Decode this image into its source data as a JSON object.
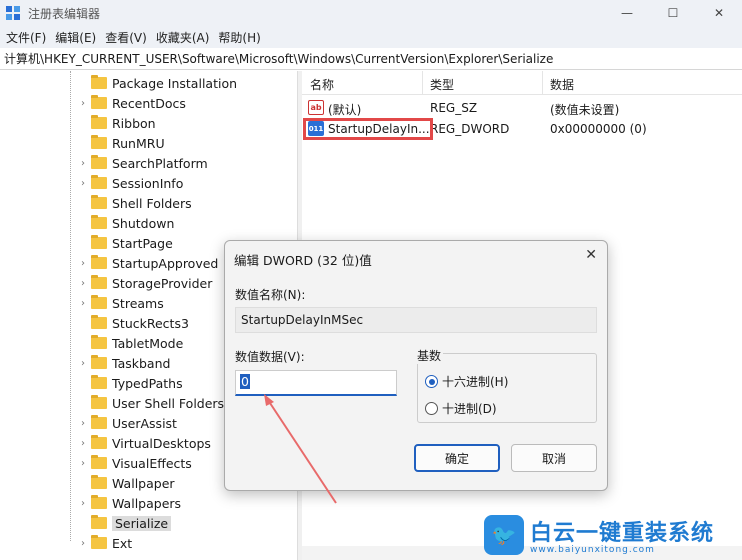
{
  "window": {
    "title": "注册表编辑器",
    "minimize": "—",
    "maximize": "☐",
    "close": "✕"
  },
  "menu": [
    "文件(F)",
    "编辑(E)",
    "查看(V)",
    "收藏夹(A)",
    "帮助(H)"
  ],
  "address": "计算机\\HKEY_CURRENT_USER\\Software\\Microsoft\\Windows\\CurrentVersion\\Explorer\\Serialize",
  "tree": {
    "items": [
      {
        "label": "Package Installation",
        "chevron": ""
      },
      {
        "label": "RecentDocs",
        "chevron": "›"
      },
      {
        "label": "Ribbon",
        "chevron": ""
      },
      {
        "label": "RunMRU",
        "chevron": ""
      },
      {
        "label": "SearchPlatform",
        "chevron": "›"
      },
      {
        "label": "SessionInfo",
        "chevron": "›"
      },
      {
        "label": "Shell Folders",
        "chevron": ""
      },
      {
        "label": "Shutdown",
        "chevron": ""
      },
      {
        "label": "StartPage",
        "chevron": ""
      },
      {
        "label": "StartupApproved",
        "chevron": "›"
      },
      {
        "label": "StorageProvider",
        "chevron": "›"
      },
      {
        "label": "Streams",
        "chevron": "›"
      },
      {
        "label": "StuckRects3",
        "chevron": ""
      },
      {
        "label": "TabletMode",
        "chevron": ""
      },
      {
        "label": "Taskband",
        "chevron": "›"
      },
      {
        "label": "TypedPaths",
        "chevron": ""
      },
      {
        "label": "User Shell Folders",
        "chevron": ""
      },
      {
        "label": "UserAssist",
        "chevron": "›"
      },
      {
        "label": "VirtualDesktops",
        "chevron": "›"
      },
      {
        "label": "VisualEffects",
        "chevron": "›"
      },
      {
        "label": "Wallpaper",
        "chevron": ""
      },
      {
        "label": "Wallpapers",
        "chevron": "›"
      },
      {
        "label": "Serialize",
        "chevron": "",
        "selected": true
      },
      {
        "label": "Ext",
        "chevron": "›"
      }
    ]
  },
  "list": {
    "headers": {
      "name": "名称",
      "type": "类型",
      "data": "数据"
    },
    "rows": [
      {
        "icon": "ab",
        "name": "(默认)",
        "type": "REG_SZ",
        "data": "(数值未设置)"
      },
      {
        "icon": "011",
        "name": "StartupDelayIn...",
        "type": "REG_DWORD",
        "data": "0x00000000 (0)"
      }
    ]
  },
  "dialog": {
    "title": "编辑 DWORD (32 位)值",
    "close": "✕",
    "name_label": "数值名称(N):",
    "name_value": "StartupDelayInMSec",
    "data_label": "数值数据(V):",
    "data_value": "0",
    "radix_label": "基数",
    "hex_option": "十六进制(H)",
    "dec_option": "十进制(D)",
    "radix_selected": "hex",
    "ok": "确定",
    "cancel": "取消"
  },
  "watermark": {
    "main": "白云一键重装系统",
    "sub": "www.baiyunxitong.com"
  },
  "colors": {
    "accent": "#1f5fbf",
    "highlight": "#e24848",
    "folder": "#f5c542"
  }
}
